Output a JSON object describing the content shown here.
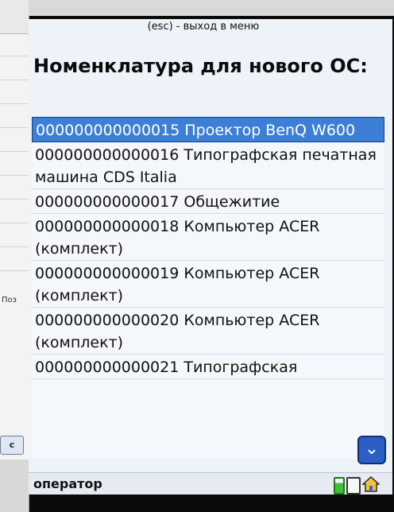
{
  "background_app": {
    "partial_label": "Поз",
    "partial_button": "c"
  },
  "screen": {
    "esc_hint": "(esc) - выход в меню",
    "title": "Номенклатура для нового ОС:",
    "items": [
      {
        "text": "000000000000015 Проектор BenQ W600",
        "selected": true
      },
      {
        "text": "000000000000016 Типографская печатная машина CDS Italia",
        "selected": false
      },
      {
        "text": "000000000000017 Общежитие",
        "selected": false
      },
      {
        "text": "000000000000018 Компьютер ACER (комплект)",
        "selected": false
      },
      {
        "text": "000000000000019 Компьютер ACER (комплект)",
        "selected": false
      },
      {
        "text": "000000000000020 Компьютер ACER (комплект)",
        "selected": false
      },
      {
        "text": "000000000000021 Типографская",
        "selected": false
      }
    ],
    "footer": {
      "user": "оператор",
      "icons": [
        "battery-icon",
        "device-icon",
        "home-icon"
      ]
    }
  },
  "colors": {
    "selection": "#3e7fd6",
    "screen_bg": "#eef3fa",
    "scroll_button": "#2b5fc4"
  }
}
